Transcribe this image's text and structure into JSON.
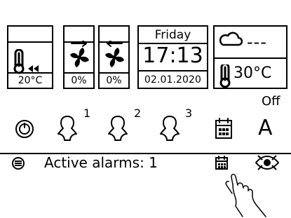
{
  "panels": {
    "room_temp": {
      "value": "20°C",
      "icon": "thermometer-boost-icon"
    },
    "fan_supply": {
      "value": "0%",
      "icon": "fan-arrow-right-icon"
    },
    "fan_exhaust": {
      "value": "0%",
      "icon": "fan-arrow-left-icon"
    }
  },
  "clock": {
    "day": "Friday",
    "time": "17:13",
    "date": "02.01.2020"
  },
  "weather": {
    "status": "---",
    "outdoor_temp": "30°C",
    "state": "Off",
    "icon": "cloud-icon"
  },
  "controls": {
    "power_icon": "power-icon",
    "user_icons": [
      {
        "icon": "user-icon",
        "label": "1"
      },
      {
        "icon": "user-icon",
        "label": "2"
      },
      {
        "icon": "user-icon",
        "label": "3"
      }
    ],
    "calendar_icon": "calendar-icon",
    "mode": "A"
  },
  "status_bar": {
    "menu_icon": "menu-icon",
    "alarm_text": "Active alarms: 1",
    "calendar_icon": "calendar-icon",
    "eye_icon": "eye-icon"
  },
  "hand_icon": "pointer-hand-icon"
}
